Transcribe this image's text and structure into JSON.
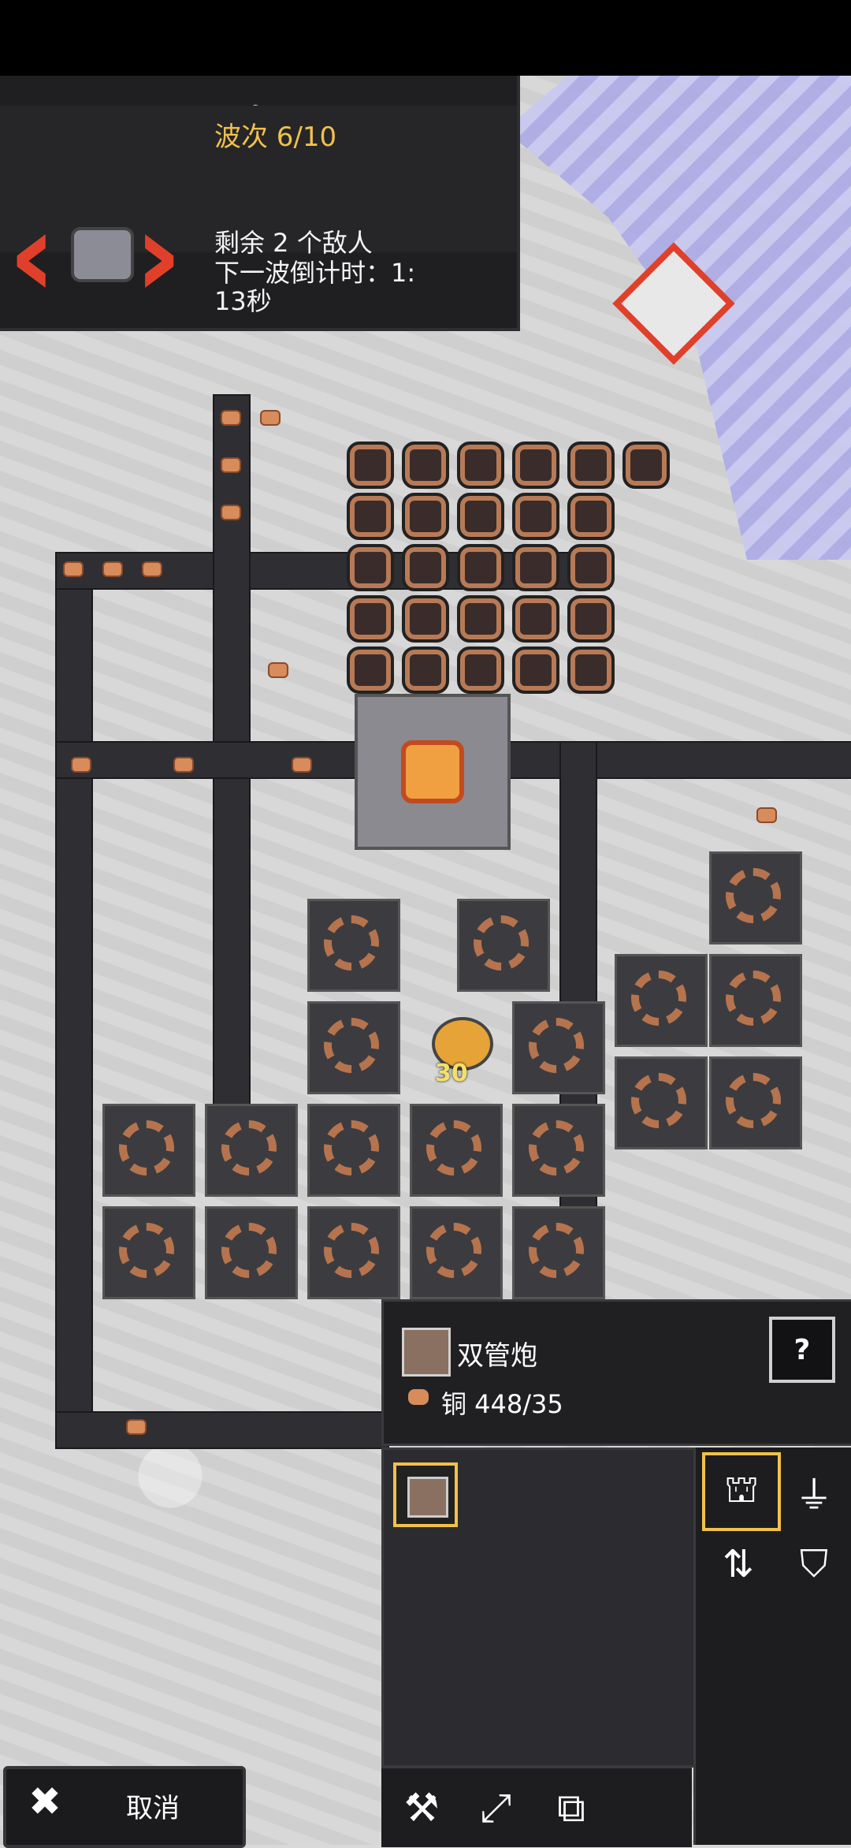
{
  "toolbar": {
    "menu_icon": "menu-list-icon",
    "up_icon": "chevron-up-icon",
    "clipboard_icon": "clipboard-icon",
    "pause_icon": "pause-icon",
    "tech_icon": "tech-tree-icon"
  },
  "wave": {
    "title": "波次 6/10",
    "enemies": "剩余 2 个敌人",
    "countdown_line1": "下一波倒计时：1:",
    "countdown_line2": "13秒"
  },
  "unit": {
    "level_label": "30"
  },
  "info_panel": {
    "name": "双管炮",
    "cost": "铜 448/35",
    "help_label": "?"
  },
  "categories": [
    {
      "icon": "turret-category-icon",
      "selected": true
    },
    {
      "icon": "production-category-icon",
      "selected": false
    },
    {
      "icon": "distribution-category-icon",
      "selected": false
    },
    {
      "icon": "defense-category-icon",
      "selected": false
    }
  ],
  "tools": [
    "hammer-icon",
    "expand-icon",
    "copy-icon"
  ],
  "cancel": {
    "label": "取消"
  },
  "colors": {
    "accent": "#f0c14b",
    "danger": "#e0402a",
    "copper": "#d88b5b"
  }
}
